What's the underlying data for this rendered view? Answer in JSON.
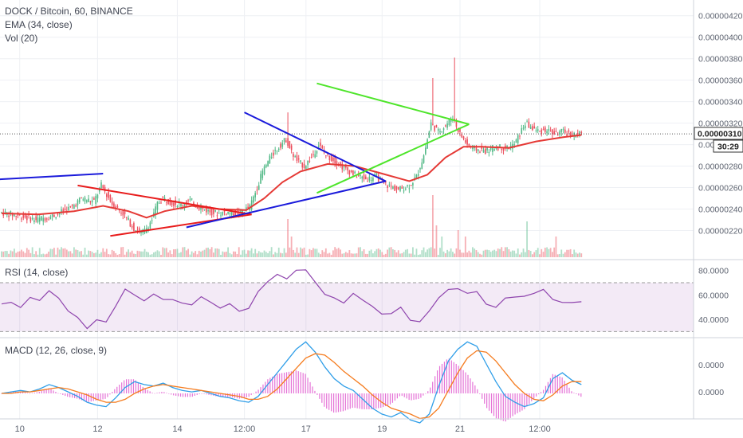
{
  "header": {
    "symbol_line": "DOCK / Bitcoin, 60, BINANCE",
    "ema_line": "EMA (34, close)",
    "vol_line": "Vol (20)"
  },
  "rsi_panel": {
    "label": "RSI (14, close)"
  },
  "macd_panel": {
    "label": "MACD (12, 26, close, 9)"
  },
  "price_badge": {
    "price": "0.00000310",
    "countdown": "30:29"
  },
  "colors": {
    "up": "#53b987",
    "down": "#eb4d5c",
    "ema": "#e53935",
    "blue_triangle": "#1a1adb",
    "red_triangle": "#e81c1c",
    "green_triangle": "#4ee52a",
    "rsi": "#8e44ad",
    "macd": "#2f9ee8",
    "signal": "#f57c1f",
    "hist_pos": "#e05ad0",
    "grid": "#eef0f4"
  },
  "chart_data": [
    {
      "type": "candlestick",
      "title": "DOCK / Bitcoin, 60, BINANCE",
      "ylim": [
        2.1e-06,
        4.25e-06
      ],
      "y_ticks": [
        "0.00000420",
        "0.00000400",
        "0.00000380",
        "0.00000360",
        "0.00000340",
        "0.00000320",
        "0.00000300",
        "0.00000280",
        "0.00000260",
        "0.00000240",
        "0.00000220"
      ],
      "x_ticks": [
        "10",
        "12",
        "14",
        "12:00",
        "17",
        "19",
        "21",
        "12:00"
      ],
      "last_price": "0.00000310",
      "overlays": [
        "EMA (34, close)",
        "Vol (20)"
      ],
      "price_path": [
        [
          0,
          2.37e-06
        ],
        [
          10,
          2.34e-06
        ],
        [
          20,
          2.3e-06
        ],
        [
          30,
          2.34e-06
        ],
        [
          40,
          2.42e-06
        ],
        [
          45,
          2.5e-06
        ],
        [
          52,
          2.47e-06
        ],
        [
          56,
          2.62e-06
        ],
        [
          62,
          2.45e-06
        ],
        [
          68,
          2.36e-06
        ],
        [
          74,
          2.22e-06
        ],
        [
          78,
          2.18e-06
        ],
        [
          80,
          2.2e-06
        ],
        [
          84,
          2.3e-06
        ],
        [
          87,
          2.45e-06
        ],
        [
          90,
          2.5e-06
        ],
        [
          95,
          2.46e-06
        ],
        [
          100,
          2.44e-06
        ],
        [
          105,
          2.48e-06
        ],
        [
          110,
          2.42e-06
        ],
        [
          115,
          2.38e-06
        ],
        [
          120,
          2.36e-06
        ],
        [
          125,
          2.37e-06
        ],
        [
          132,
          2.36e-06
        ],
        [
          138,
          2.42e-06
        ],
        [
          142,
          2.6e-06
        ],
        [
          145,
          2.75e-06
        ],
        [
          150,
          2.9e-06
        ],
        [
          155,
          3e-06
        ],
        [
          158,
          3.05e-06
        ],
        [
          161,
          2.93e-06
        ],
        [
          164,
          2.85e-06
        ],
        [
          168,
          2.8e-06
        ],
        [
          172,
          2.88e-06
        ],
        [
          176,
          3e-06
        ],
        [
          180,
          2.9e-06
        ],
        [
          185,
          2.85e-06
        ],
        [
          190,
          2.78e-06
        ],
        [
          196,
          2.72e-06
        ],
        [
          202,
          2.68e-06
        ],
        [
          208,
          2.7e-06
        ],
        [
          214,
          2.62e-06
        ],
        [
          220,
          2.58e-06
        ],
        [
          226,
          2.62e-06
        ],
        [
          230,
          2.7e-06
        ],
        [
          234,
          2.9e-06
        ],
        [
          238,
          3.2e-06
        ],
        [
          242,
          3.12e-06
        ],
        [
          246,
          3.18e-06
        ],
        [
          250,
          3.25e-06
        ],
        [
          254,
          3.1e-06
        ],
        [
          258,
          3e-06
        ],
        [
          262,
          2.96e-06
        ],
        [
          268,
          2.94e-06
        ],
        [
          274,
          2.98e-06
        ],
        [
          280,
          2.97e-06
        ],
        [
          284,
          3e-06
        ],
        [
          290,
          3.2e-06
        ],
        [
          294,
          3.15e-06
        ],
        [
          298,
          3.12e-06
        ],
        [
          302,
          3.14e-06
        ],
        [
          306,
          3.1e-06
        ],
        [
          310,
          3.12e-06
        ],
        [
          314,
          3.1e-06
        ],
        [
          318,
          3.09e-06
        ],
        [
          320,
          3.1e-06
        ]
      ],
      "ema_path": [
        [
          0,
          2.36e-06
        ],
        [
          20,
          2.35e-06
        ],
        [
          40,
          2.38e-06
        ],
        [
          56,
          2.43e-06
        ],
        [
          70,
          2.38e-06
        ],
        [
          80,
          2.32e-06
        ],
        [
          90,
          2.38e-06
        ],
        [
          105,
          2.43e-06
        ],
        [
          120,
          2.4e-06
        ],
        [
          135,
          2.39e-06
        ],
        [
          145,
          2.5e-06
        ],
        [
          155,
          2.65e-06
        ],
        [
          165,
          2.75e-06
        ],
        [
          180,
          2.82e-06
        ],
        [
          195,
          2.8e-06
        ],
        [
          210,
          2.73e-06
        ],
        [
          225,
          2.66e-06
        ],
        [
          235,
          2.72e-06
        ],
        [
          245,
          2.88e-06
        ],
        [
          255,
          2.98e-06
        ],
        [
          265,
          2.98e-06
        ],
        [
          280,
          2.97e-06
        ],
        [
          295,
          3.03e-06
        ],
        [
          310,
          3.07e-06
        ],
        [
          320,
          3.09e-06
        ]
      ],
      "trend_lines": [
        {
          "name": "blue-left",
          "points": [
            [
              -20,
              2.66e-06
            ],
            [
              56,
              2.73e-06
            ]
          ]
        },
        {
          "name": "red-upper",
          "points": [
            [
              42,
              2.62e-06
            ],
            [
              138,
              2.35e-06
            ]
          ]
        },
        {
          "name": "red-lower",
          "points": [
            [
              60,
              2.15e-06
            ],
            [
              138,
              2.35e-06
            ]
          ]
        },
        {
          "name": "blue-lower",
          "points": [
            [
              102,
              2.23e-06
            ],
            [
              212,
              2.66e-06
            ]
          ]
        },
        {
          "name": "blue-upper",
          "points": [
            [
              134,
              3.3e-06
            ],
            [
              212,
              2.66e-06
            ]
          ]
        },
        {
          "name": "green-upper",
          "points": [
            [
              174,
              3.57e-06
            ],
            [
              258,
              3.19e-06
            ]
          ]
        },
        {
          "name": "green-lower",
          "points": [
            [
              174,
              2.55e-06
            ],
            [
              258,
              3.19e-06
            ]
          ]
        }
      ]
    },
    {
      "type": "line",
      "title": "RSI (14, close)",
      "ylim": [
        25,
        85
      ],
      "y_ticks": [
        "80.0000",
        "60.0000",
        "40.0000"
      ],
      "band": [
        30,
        70
      ],
      "series": [
        {
          "values": [
            52,
            55,
            50,
            58,
            54,
            62,
            58,
            45,
            40,
            32,
            38,
            36,
            50,
            66,
            60,
            57,
            62,
            55,
            58,
            54,
            52,
            60,
            56,
            48,
            52,
            46,
            50,
            64,
            70,
            78,
            75,
            80,
            82,
            70,
            60,
            58,
            54,
            62,
            56,
            50,
            46,
            44,
            48,
            40,
            38,
            46,
            58,
            65,
            66,
            60,
            62,
            54,
            48,
            56,
            58,
            60,
            62,
            66,
            58,
            54,
            55,
            53
          ]
        }
      ]
    },
    {
      "type": "line",
      "title": "MACD (12, 26, close, 9)",
      "ylim": [
        -3e-08,
        4.2e-08
      ],
      "y_ticks": [
        "0.0000",
        "0.0000"
      ],
      "series": [
        {
          "name": "MACD",
          "values": [
            0.0,
            0.0,
            0.0,
            0.0,
            0.0,
            0.0,
            0.0,
            0.0,
            0.0,
            0.0,
            0.0,
            0.0,
            0.0,
            0.0,
            0.0,
            0.0,
            0.0,
            0.0,
            0.0,
            0.0,
            0.0,
            0.0,
            0.0,
            0.0,
            0.0,
            0.0,
            0.0,
            0.0,
            0.0,
            0.0,
            0.0,
            0.0,
            0.0,
            0.0,
            0.0,
            0.0,
            0.0,
            0.0,
            0.0,
            0.0,
            0.0,
            0.0,
            0.0,
            0.0,
            0.0,
            0.0,
            0.0,
            0.0,
            0.0,
            0.0,
            0.0,
            0.0,
            0.0,
            0.0,
            0.0,
            0.0,
            0.0,
            0.0,
            0.0,
            0.0,
            0.0,
            0.0
          ]
        },
        {
          "name": "Signal",
          "values": [
            0.0,
            0.0,
            0.0,
            0.0,
            0.0,
            0.0,
            0.0,
            0.0,
            0.0,
            0.0,
            0.0,
            0.0,
            0.0,
            0.0,
            0.0,
            0.0,
            0.0,
            0.0,
            0.0,
            0.0,
            0.0,
            0.0,
            0.0,
            0.0,
            0.0,
            0.0,
            0.0,
            0.0,
            0.0,
            0.0,
            0.0,
            0.0,
            0.0,
            0.0,
            0.0,
            0.0,
            0.0,
            0.0,
            0.0,
            0.0,
            0.0,
            0.0,
            0.0,
            0.0,
            0.0,
            0.0,
            0.0,
            0.0,
            0.0,
            0.0,
            0.0,
            0.0,
            0.0,
            0.0,
            0.0,
            0.0,
            0.0,
            0.0,
            0.0,
            0.0,
            0.0,
            0.0
          ]
        }
      ],
      "macd_shape": [
        0,
        1,
        2,
        1,
        3,
        6,
        4,
        1,
        -2,
        -6,
        -8,
        -9,
        -3,
        4,
        8,
        6,
        5,
        7,
        4,
        2,
        1,
        2,
        0,
        -2,
        -3,
        -5,
        -6,
        -2,
        6,
        14,
        22,
        30,
        35,
        28,
        18,
        10,
        5,
        2,
        -4,
        -10,
        -14,
        -16,
        -13,
        -18,
        -20,
        -14,
        5,
        22,
        30,
        35,
        32,
        20,
        8,
        -2,
        -6,
        -9,
        -7,
        -3,
        10,
        14,
        9,
        6
      ],
      "signal_shape": [
        0,
        0,
        1,
        1,
        2,
        3,
        4,
        3,
        1,
        -1,
        -4,
        -6,
        -6,
        -4,
        0,
        3,
        5,
        6,
        5,
        4,
        3,
        2,
        1,
        0,
        -1,
        -2,
        -4,
        -4,
        -2,
        3,
        10,
        17,
        24,
        27,
        26,
        21,
        15,
        10,
        5,
        -1,
        -6,
        -10,
        -12,
        -14,
        -17,
        -16,
        -10,
        2,
        14,
        24,
        29,
        28,
        22,
        14,
        6,
        0,
        -4,
        -5,
        -1,
        5,
        8,
        8
      ],
      "x_ticks": [
        "10",
        "12",
        "14",
        "12:00",
        "17",
        "19",
        "21",
        "12:00"
      ]
    }
  ]
}
